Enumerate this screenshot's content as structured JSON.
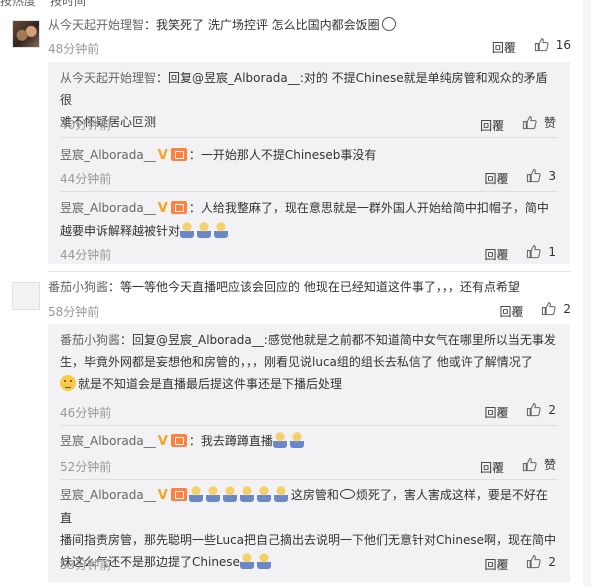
{
  "topcut": {
    "a": "按热度",
    "b": "按时间"
  },
  "c1": {
    "user": "从今天起开始理智",
    "text": "：我笑死了 洗广场控评 怎么比国内都会饭圈",
    "time": "48分钟前",
    "reply": "回覆",
    "likes": "16"
  },
  "r1": {
    "user": "从今天起开始理智",
    "text_line1": "：回复@昱宸_Alborada__:对的 不提Chinese就是单纯房管和观众的矛盾 很",
    "text_line2": "难不怀疑居心叵测",
    "time": "40分钟前",
    "reply": "回覆",
    "likes": "赞"
  },
  "r2": {
    "user": "昱宸_Alborada__",
    "v": "V",
    "text": "：一开始那人不提Chineseb事没有",
    "time": "44分钟前",
    "reply": "回覆",
    "likes": "3"
  },
  "r3": {
    "user": "昱宸_Alborada__",
    "v": "V",
    "text_line1": "：人给我整麻了，现在意思就是一群外国人开始给简中扣帽子，简中",
    "text_line2": "越要申诉解释越被针对",
    "time": "44分钟前",
    "reply": "回覆",
    "likes": "1"
  },
  "c2": {
    "user": "番茄小狗酱",
    "text": "：等一等他今天直播吧应该会回应的 他现在已经知道这件事了，，，还有点希望",
    "time": "58分钟前",
    "reply": "回覆",
    "likes": "2"
  },
  "r4": {
    "user": "番茄小狗酱",
    "text_line1": "：回复@昱宸_Alborada__:感觉他就是之前都不知道简中女气在哪里所以当无事发",
    "text_line2": "生，毕竟外网都是妄想他和房管的，，，刚看见说luca组的组长去私信了 他或许了解情况了",
    "text_line3": "就是不知道会是直播最后提这件事还是下播后处理",
    "time": "46分钟前",
    "reply": "回覆",
    "likes": "2"
  },
  "r5": {
    "user": "昱宸_Alborada__",
    "v": "V",
    "text": "：我去蹲蹲直播",
    "time": "52分钟前",
    "reply": "回覆",
    "likes": "赞"
  },
  "r6": {
    "user": "昱宸_Alborada__",
    "v": "V",
    "text_line1a": "这房管和",
    "text_line1b": "烦死了，害人害成这样，要是不好在直",
    "text_line2": "播间指责房管，那先聪明一些Luca把自己摘出去说明一下他们无意针对Chinese啊，现在简中",
    "text_line3": "妹这么气还不是那边提了Chinese",
    "time": "53分钟前",
    "reply": "回覆",
    "likes": "2"
  }
}
